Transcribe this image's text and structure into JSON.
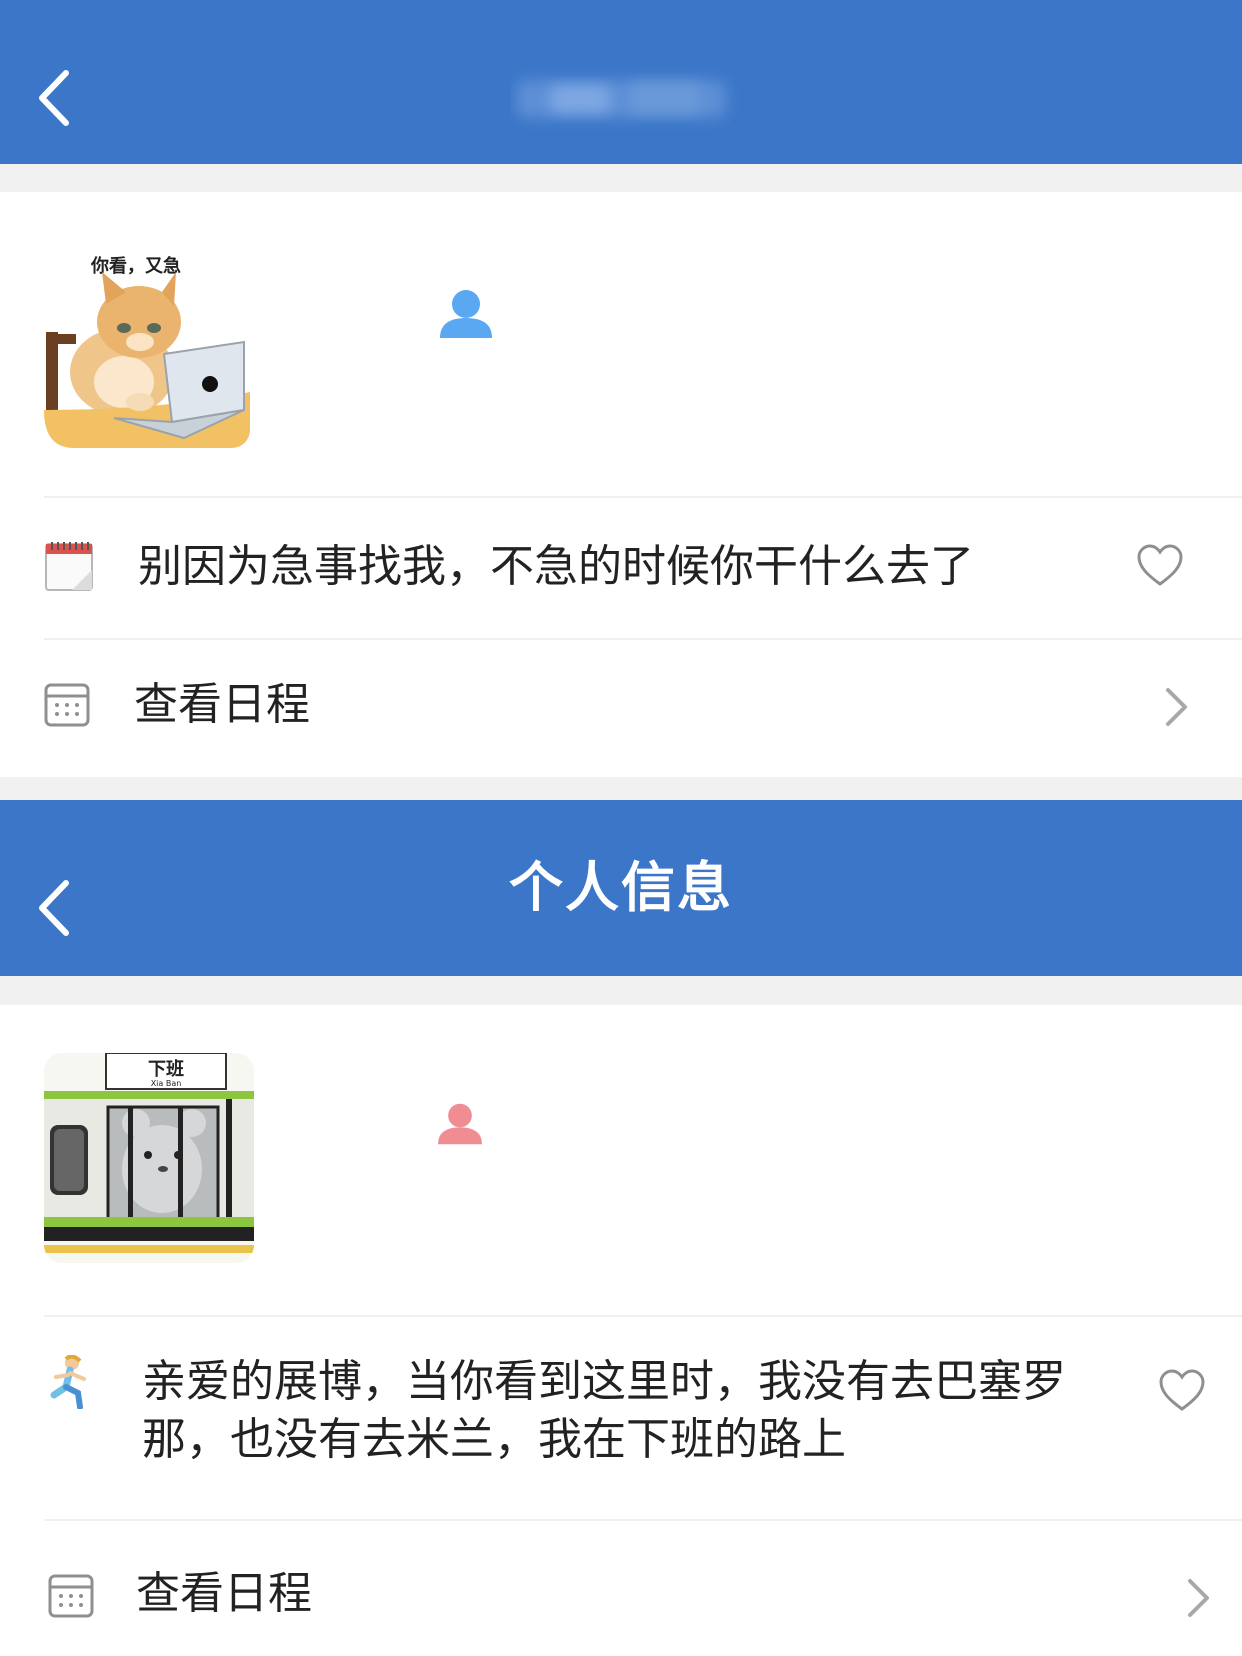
{
  "colors": {
    "topbar": "#3b76c8",
    "male_icon": "#5aa7f2",
    "female_icon": "#f08d92",
    "text": "#222222",
    "icon_gray": "#8f8f8f"
  },
  "screen_1": {
    "header": {
      "back_icon": "chevron-left-icon",
      "title": ""
    },
    "profile": {
      "avatar_caption": "你看，又急",
      "gender_icon": "person-icon"
    },
    "signature": {
      "icon": "calendar-emoji-icon",
      "text": "别因为急事找我，不急的时候你干什么去了",
      "like_icon": "heart-outline-icon"
    },
    "schedule": {
      "icon": "calendar-icon",
      "label": "查看日程",
      "chevron_icon": "chevron-right-icon"
    }
  },
  "screen_2": {
    "header": {
      "back_icon": "chevron-left-icon",
      "title": "个人信息"
    },
    "profile": {
      "avatar_caption": "下班",
      "avatar_caption_small": "Xia Ban",
      "gender_icon": "person-icon"
    },
    "signature": {
      "icon": "running-woman-emoji-icon",
      "text_line1": "亲爱的展博，当你看到这里时，我没有去巴塞罗",
      "text_line2": "那，也没有去米兰，我在下班的路上",
      "like_icon": "heart-outline-icon"
    },
    "schedule": {
      "icon": "calendar-icon",
      "label": "查看日程",
      "chevron_icon": "chevron-right-icon"
    }
  }
}
